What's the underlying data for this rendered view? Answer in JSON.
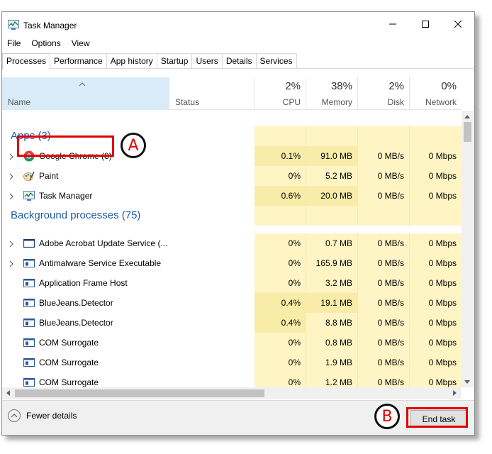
{
  "window": {
    "title": "Task Manager",
    "controls": {
      "minimize": "minimize",
      "maximize": "maximize",
      "close": "close"
    }
  },
  "menu": [
    "File",
    "Options",
    "View"
  ],
  "tabs": [
    "Processes",
    "Performance",
    "App history",
    "Startup",
    "Users",
    "Details",
    "Services"
  ],
  "active_tab": "Processes",
  "columns": {
    "name": "Name",
    "status": "Status",
    "cpu": {
      "pct": "2%",
      "label": "CPU"
    },
    "memory": {
      "pct": "38%",
      "label": "Memory"
    },
    "disk": {
      "pct": "2%",
      "label": "Disk"
    },
    "network": {
      "pct": "0%",
      "label": "Network"
    }
  },
  "groups": {
    "apps": "Apps (3)",
    "background": "Background processes (75)"
  },
  "apps": [
    {
      "name": "Google Chrome (8)",
      "icon": "chrome-icon",
      "expandable": true,
      "cpu": "0.1%",
      "memory": "91.0 MB",
      "disk": "0 MB/s",
      "network": "0 Mbps"
    },
    {
      "name": "Paint",
      "icon": "paint-icon",
      "expandable": true,
      "cpu": "0%",
      "memory": "5.2 MB",
      "disk": "0 MB/s",
      "network": "0 Mbps"
    },
    {
      "name": "Task Manager",
      "icon": "task-manager-icon",
      "expandable": true,
      "cpu": "0.6%",
      "memory": "20.0 MB",
      "disk": "0 MB/s",
      "network": "0 Mbps"
    }
  ],
  "background": [
    {
      "name": "Adobe Acrobat Update Service (...",
      "icon": "window-icon",
      "expandable": true,
      "cpu": "0%",
      "memory": "0.7 MB",
      "disk": "0 MB/s",
      "network": "0 Mbps"
    },
    {
      "name": "Antimalware Service Executable",
      "icon": "service-icon",
      "expandable": true,
      "cpu": "0%",
      "memory": "165.9 MB",
      "disk": "0 MB/s",
      "network": "0 Mbps"
    },
    {
      "name": "Application Frame Host",
      "icon": "service-icon",
      "expandable": false,
      "cpu": "0%",
      "memory": "3.2 MB",
      "disk": "0 MB/s",
      "network": "0 Mbps"
    },
    {
      "name": "BlueJeans.Detector",
      "icon": "service-icon",
      "expandable": false,
      "cpu": "0.4%",
      "memory": "19.1 MB",
      "disk": "0 MB/s",
      "network": "0 Mbps"
    },
    {
      "name": "BlueJeans.Detector",
      "icon": "service-icon",
      "expandable": false,
      "cpu": "0.4%",
      "memory": "8.8 MB",
      "disk": "0 MB/s",
      "network": "0 Mbps"
    },
    {
      "name": "COM Surrogate",
      "icon": "service-icon",
      "expandable": false,
      "cpu": "0%",
      "memory": "0.8 MB",
      "disk": "0 MB/s",
      "network": "0 Mbps"
    },
    {
      "name": "COM Surrogate",
      "icon": "service-icon",
      "expandable": false,
      "cpu": "0%",
      "memory": "1.9 MB",
      "disk": "0 MB/s",
      "network": "0 Mbps"
    },
    {
      "name": "COM Surrogate",
      "icon": "service-icon",
      "expandable": false,
      "cpu": "0%",
      "memory": "1.2 MB",
      "disk": "0 MB/s",
      "network": "0 Mbps"
    }
  ],
  "footer": {
    "fewer_details": "Fewer details",
    "end_task": "End task"
  },
  "annotations": {
    "a": "A",
    "b": "B"
  },
  "colors": {
    "accent": "#1e5aa8",
    "heat_light": "#fff4c4",
    "heat_dark": "#f9eca8",
    "annotation_red": "#e00000",
    "header_selected": "#d9ebf9"
  }
}
